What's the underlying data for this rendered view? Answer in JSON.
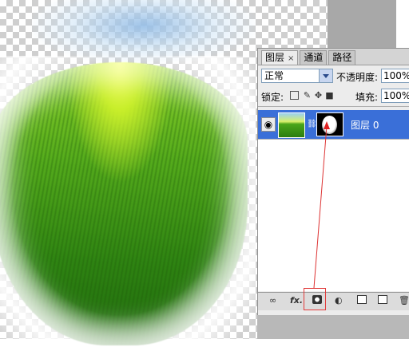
{
  "panel": {
    "tabs": [
      {
        "label": "图层",
        "close": "×",
        "active": true
      },
      {
        "label": "通道",
        "active": false
      },
      {
        "label": "路径",
        "active": false
      }
    ],
    "blend_mode": "正常",
    "opacity_label": "不透明度:",
    "opacity_value": "100%",
    "lock_label": "锁定:",
    "fill_label": "填充:",
    "fill_value": "100%",
    "layer": {
      "name": "图层 0",
      "visible": true,
      "icon": "eye-icon",
      "link": "chain-icon"
    },
    "bottom_icons": [
      "link-layers-icon",
      "fx-icon",
      "add-mask-icon",
      "adjustment-layer-icon",
      "new-group-icon",
      "new-layer-icon",
      "delete-icon"
    ],
    "fx_label": "fx."
  },
  "annotation": {
    "color": "#e23b3b",
    "target": "add-mask-button"
  },
  "colors": {
    "selected_row": "#3a6fd8",
    "panel_bg": "#ececec"
  }
}
